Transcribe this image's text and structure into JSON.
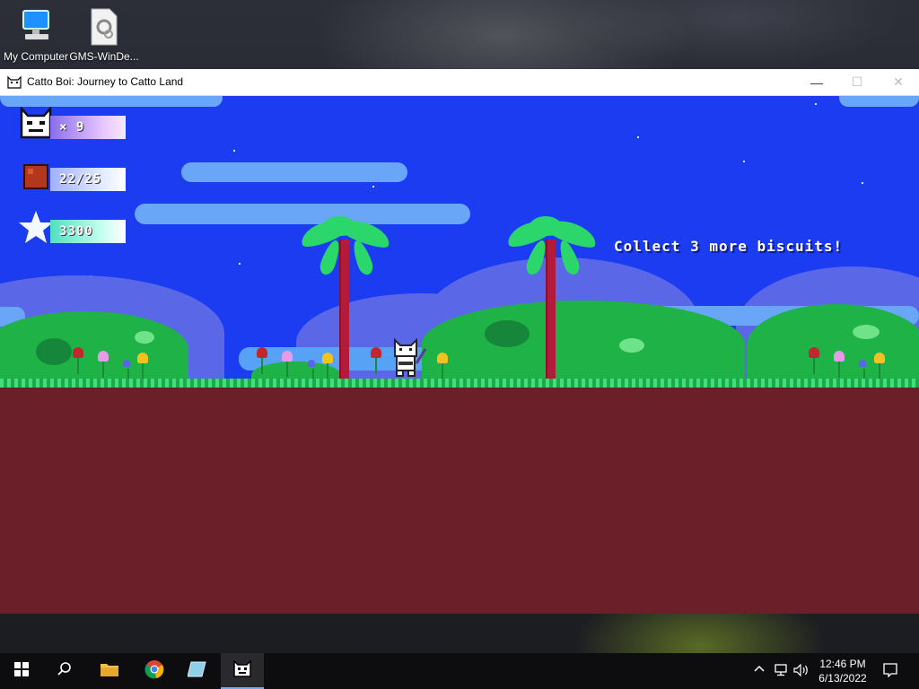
{
  "desktop": {
    "icons": [
      {
        "label": "My Computer",
        "icon": "computer-icon"
      },
      {
        "label": "GMS-WinDe...",
        "icon": "settings-file-icon"
      }
    ]
  },
  "window": {
    "title": "Catto Boi: Journey to Catto Land",
    "controls": {
      "minimize": "—",
      "maximize": "☐",
      "close": "✕"
    }
  },
  "hud": {
    "lives": "× 9",
    "biscuits": "22/25",
    "score": "3300",
    "message": "Collect 3 more biscuits!"
  },
  "colors": {
    "sky": "#1b3cf0",
    "ground": "#6b1f28",
    "grass": "#3fe07a",
    "palm_trunk": "#b21b3a",
    "palm_leaves": "#2bd66a"
  },
  "taskbar": {
    "items": [
      "start-icon",
      "search-icon",
      "file-explorer-icon",
      "chrome-icon",
      "app-icon",
      "catto-boi-icon"
    ],
    "time": "12:46 PM",
    "date": "6/13/2022"
  }
}
